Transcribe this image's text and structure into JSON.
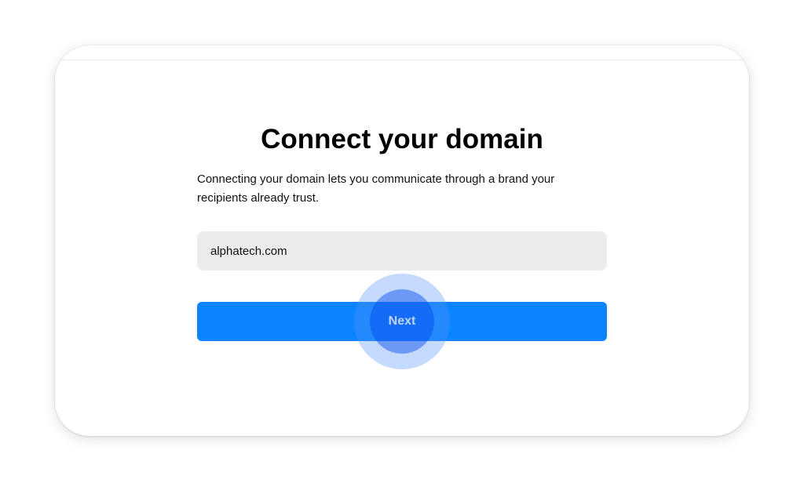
{
  "page": {
    "title": "Connect your domain",
    "description": "Connecting your domain lets you communicate through a brand your recipients already trust."
  },
  "form": {
    "domain_value": "alphatech.com",
    "next_label": "Next"
  },
  "colors": {
    "accent": "#0a84ff",
    "input_background": "#ececec",
    "click_indicator": "#3d7bff"
  }
}
